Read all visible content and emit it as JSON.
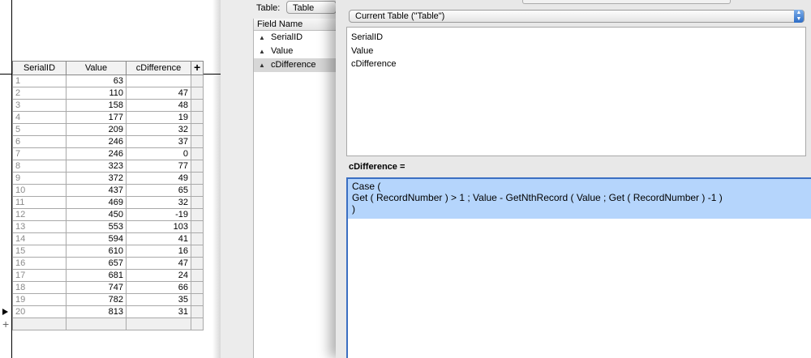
{
  "data_grid": {
    "columns": [
      "SerialID",
      "Value",
      "cDifference"
    ],
    "add_field_label": "+",
    "rows": [
      {
        "id": "1",
        "value": "63",
        "diff": ""
      },
      {
        "id": "2",
        "value": "110",
        "diff": "47"
      },
      {
        "id": "3",
        "value": "158",
        "diff": "48"
      },
      {
        "id": "4",
        "value": "177",
        "diff": "19"
      },
      {
        "id": "5",
        "value": "209",
        "diff": "32"
      },
      {
        "id": "6",
        "value": "246",
        "diff": "37"
      },
      {
        "id": "7",
        "value": "246",
        "diff": "0"
      },
      {
        "id": "8",
        "value": "323",
        "diff": "77"
      },
      {
        "id": "9",
        "value": "372",
        "diff": "49"
      },
      {
        "id": "10",
        "value": "437",
        "diff": "65"
      },
      {
        "id": "11",
        "value": "469",
        "diff": "32"
      },
      {
        "id": "12",
        "value": "450",
        "diff": "-19"
      },
      {
        "id": "13",
        "value": "553",
        "diff": "103"
      },
      {
        "id": "14",
        "value": "594",
        "diff": "41"
      },
      {
        "id": "15",
        "value": "610",
        "diff": "16"
      },
      {
        "id": "16",
        "value": "657",
        "diff": "47"
      },
      {
        "id": "17",
        "value": "681",
        "diff": "24"
      },
      {
        "id": "18",
        "value": "747",
        "diff": "66"
      },
      {
        "id": "19",
        "value": "782",
        "diff": "35"
      },
      {
        "id": "20",
        "value": "813",
        "diff": "31"
      }
    ],
    "add_record_label": "+"
  },
  "manage_db": {
    "table_label": "Table:",
    "table_value": "Table",
    "field_list_header": "Field Name",
    "fields": [
      "SerialID",
      "Value",
      "cDifference"
    ]
  },
  "calc_dialog": {
    "context_select": "Current Table (\"Table\")",
    "field_items": [
      "SerialID",
      "Value",
      "cDifference"
    ],
    "calc_label": "cDifference =",
    "formula_lines": [
      "Case (",
      "Get ( RecordNumber ) > 1 ; Value - GetNthRecord ( Value ; Get ( RecordNumber ) -1 )",
      ")"
    ]
  }
}
